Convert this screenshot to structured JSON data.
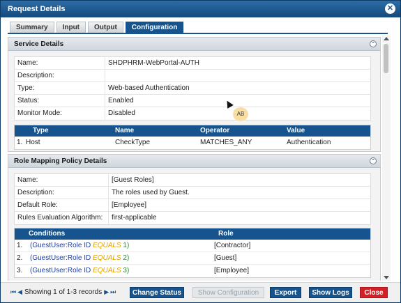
{
  "dialog": {
    "title": "Request Details",
    "close_glyph": "✕"
  },
  "tabs": [
    {
      "label": "Summary",
      "active": false
    },
    {
      "label": "Input",
      "active": false
    },
    {
      "label": "Output",
      "active": false
    },
    {
      "label": "Configuration",
      "active": true
    }
  ],
  "service_details": {
    "header": "Service Details",
    "fields": [
      {
        "key": "Name:",
        "value": "SHDPHRM-WebPortal-AUTH"
      },
      {
        "key": "Description:",
        "value": ""
      },
      {
        "key": "Type:",
        "value": "Web-based Authentication"
      },
      {
        "key": "Status:",
        "value": "Enabled"
      },
      {
        "key": "Monitor Mode:",
        "value": "Disabled"
      }
    ],
    "rules": {
      "columns": [
        "Type",
        "Name",
        "Operator",
        "Value"
      ],
      "rows": [
        {
          "index": "1.",
          "type": "Host",
          "name": "CheckType",
          "operator": "MATCHES_ANY",
          "value": "Authentication"
        }
      ]
    }
  },
  "role_mapping": {
    "header": "Role Mapping Policy Details",
    "fields": [
      {
        "key": "Name:",
        "value": "[Guest Roles]"
      },
      {
        "key": "Description:",
        "value": "The roles used by Guest."
      },
      {
        "key": "Default Role:",
        "value": "[Employee]"
      },
      {
        "key": "Rules Evaluation Algorithm:",
        "value": "first-applicable"
      }
    ],
    "rules": {
      "columns": [
        "Conditions",
        "Role"
      ],
      "rows": [
        {
          "index": "1.",
          "attr": "(GuestUser:Role ID",
          "op": "EQUALS",
          "val": "1)",
          "role": "[Contractor]"
        },
        {
          "index": "2.",
          "attr": "(GuestUser:Role ID",
          "op": "EQUALS",
          "val": "2)",
          "role": "[Guest]"
        },
        {
          "index": "3.",
          "attr": "(GuestUser:Role ID",
          "op": "EQUALS",
          "val": "3)",
          "role": "[Employee]"
        }
      ]
    }
  },
  "overlay": {
    "avatar_initials": "AB"
  },
  "footer": {
    "pager_text": "Showing 1 of 1-3 records",
    "buttons": {
      "change_status": "Change Status",
      "show_configuration": "Show Configuration",
      "export": "Export",
      "show_logs": "Show Logs",
      "close": "Close"
    }
  },
  "colors": {
    "accent": "#17538c",
    "close_button": "#d41f26",
    "condition_attr": "#1f3fa0",
    "condition_op": "#e0a000",
    "condition_val": "#2e8b2e"
  }
}
